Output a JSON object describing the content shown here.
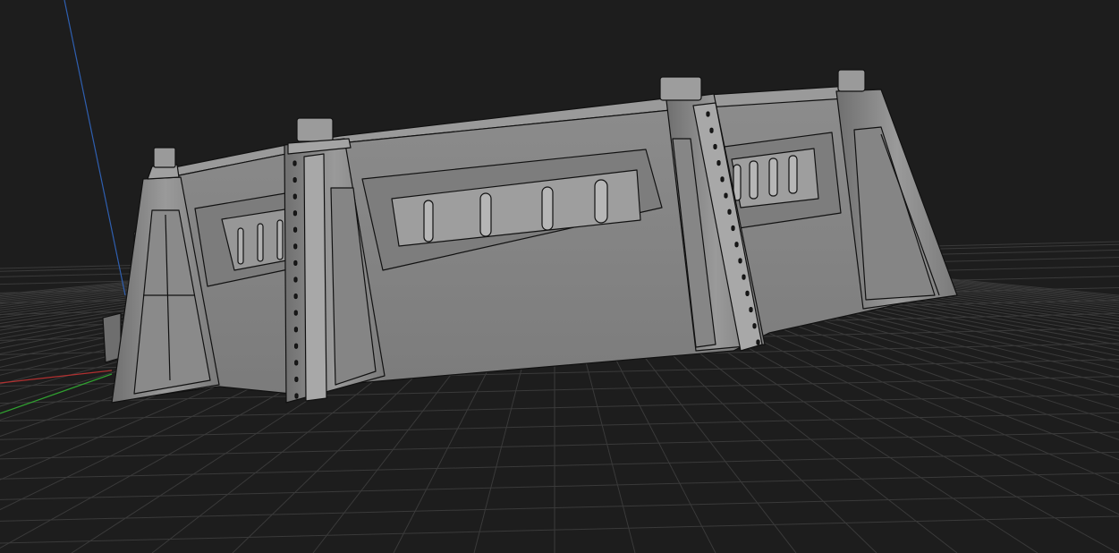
{
  "viewport": {
    "background": "#1d1d1d",
    "grid_color": "#3a3a3a",
    "model_color": "#8a8a8a",
    "edge_color": "#111111"
  },
  "axes": {
    "x_color": "#b03030",
    "y_color": "#30a030",
    "z_color": "#2f5fb0"
  }
}
